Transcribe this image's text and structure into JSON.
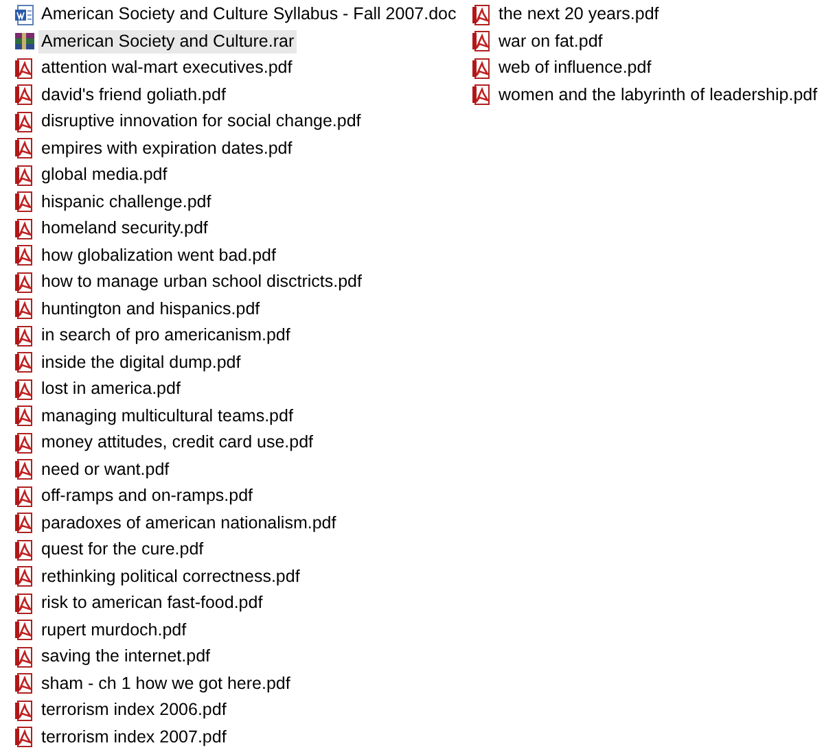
{
  "columns": [
    {
      "files": [
        {
          "name": "American Society and Culture Syllabus - Fall 2007.doc",
          "kind": "doc",
          "selected": false
        },
        {
          "name": "American Society and Culture.rar",
          "kind": "rar",
          "selected": true
        },
        {
          "name": "attention wal-mart executives.pdf",
          "kind": "pdf",
          "selected": false
        },
        {
          "name": "david's friend goliath.pdf",
          "kind": "pdf",
          "selected": false
        },
        {
          "name": "disruptive innovation for social change.pdf",
          "kind": "pdf",
          "selected": false
        },
        {
          "name": "empires with expiration dates.pdf",
          "kind": "pdf",
          "selected": false
        },
        {
          "name": "global media.pdf",
          "kind": "pdf",
          "selected": false
        },
        {
          "name": "hispanic challenge.pdf",
          "kind": "pdf",
          "selected": false
        },
        {
          "name": "homeland security.pdf",
          "kind": "pdf",
          "selected": false
        },
        {
          "name": "how globalization went bad.pdf",
          "kind": "pdf",
          "selected": false
        },
        {
          "name": "how to manage urban school disctricts.pdf",
          "kind": "pdf",
          "selected": false
        },
        {
          "name": "huntington and hispanics.pdf",
          "kind": "pdf",
          "selected": false
        },
        {
          "name": "in search of pro americanism.pdf",
          "kind": "pdf",
          "selected": false
        },
        {
          "name": "inside the digital dump.pdf",
          "kind": "pdf",
          "selected": false
        },
        {
          "name": "lost in america.pdf",
          "kind": "pdf",
          "selected": false
        },
        {
          "name": "managing multicultural teams.pdf",
          "kind": "pdf",
          "selected": false
        },
        {
          "name": "money attitudes, credit card use.pdf",
          "kind": "pdf",
          "selected": false
        },
        {
          "name": "need or want.pdf",
          "kind": "pdf",
          "selected": false
        },
        {
          "name": "off-ramps and on-ramps.pdf",
          "kind": "pdf",
          "selected": false
        },
        {
          "name": "paradoxes of american nationalism.pdf",
          "kind": "pdf",
          "selected": false
        },
        {
          "name": "quest for the cure.pdf",
          "kind": "pdf",
          "selected": false
        },
        {
          "name": "rethinking political correctness.pdf",
          "kind": "pdf",
          "selected": false
        },
        {
          "name": "risk to american fast-food.pdf",
          "kind": "pdf",
          "selected": false
        },
        {
          "name": "rupert murdoch.pdf",
          "kind": "pdf",
          "selected": false
        },
        {
          "name": "saving the internet.pdf",
          "kind": "pdf",
          "selected": false
        },
        {
          "name": "sham - ch 1 how we got here.pdf",
          "kind": "pdf",
          "selected": false
        },
        {
          "name": "terrorism index 2006.pdf",
          "kind": "pdf",
          "selected": false
        },
        {
          "name": "terrorism index 2007.pdf",
          "kind": "pdf",
          "selected": false
        }
      ]
    },
    {
      "files": [
        {
          "name": "the next 20 years.pdf",
          "kind": "pdf",
          "selected": false
        },
        {
          "name": "war on fat.pdf",
          "kind": "pdf",
          "selected": false
        },
        {
          "name": "web of influence.pdf",
          "kind": "pdf",
          "selected": false
        },
        {
          "name": "women and the labyrinth of leadership.pdf",
          "kind": "pdf",
          "selected": false
        }
      ]
    }
  ]
}
